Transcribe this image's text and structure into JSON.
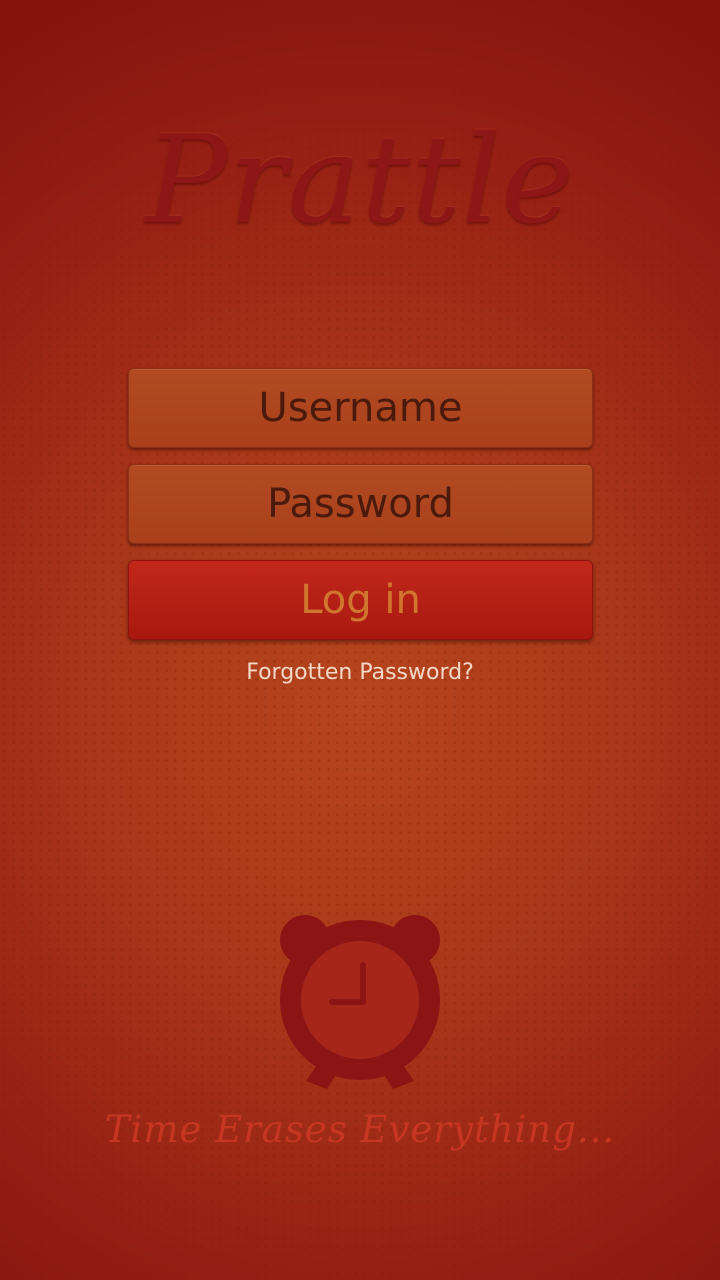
{
  "app": {
    "logo": "Prattle",
    "tagline": "Time Erases Everything..."
  },
  "login_form": {
    "username_placeholder": "Username",
    "password_placeholder": "Password",
    "login_label": "Log in",
    "forgot_label": "Forgotten Password?"
  },
  "icons": {
    "clock": "alarm-clock-icon"
  },
  "colors": {
    "background": "#a9381a",
    "logo": "#8d1616",
    "login_button": "#b8201a",
    "login_text": "#d0762f",
    "tagline": "#c63623"
  }
}
